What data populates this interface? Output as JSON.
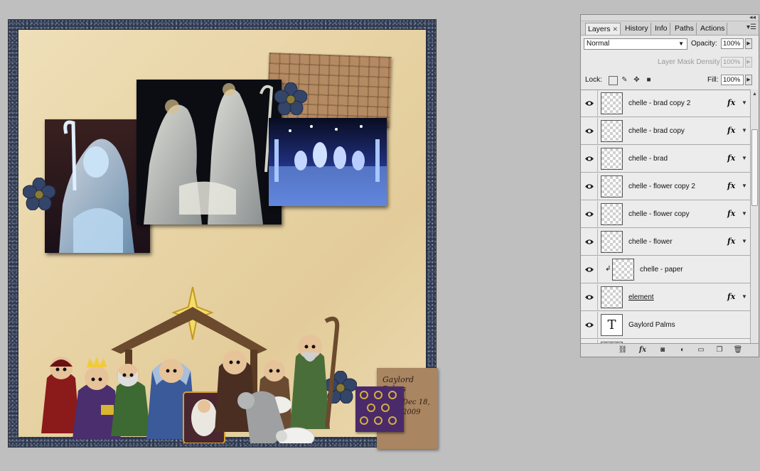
{
  "canvas": {
    "journaling_title": "Gaylord Palms",
    "journaling_date": "Dec 18, 2009"
  },
  "layers_panel": {
    "tabs": [
      {
        "label": "Layers",
        "active": true
      },
      {
        "label": "History",
        "active": false
      },
      {
        "label": "Info",
        "active": false
      },
      {
        "label": "Paths",
        "active": false
      },
      {
        "label": "Actions",
        "active": false
      }
    ],
    "blend_mode": "Normal",
    "opacity_label": "Opacity:",
    "opacity_value": "100%",
    "mask_density_label": "Layer Mask Density",
    "mask_density_value": "100%",
    "lock_label": "Lock:",
    "fill_label": "Fill:",
    "fill_value": "100%",
    "layers": [
      {
        "name": "chelle - brad copy 2",
        "thumb": "transparent",
        "fx": "fx"
      },
      {
        "name": "chelle - brad copy",
        "thumb": "transparent",
        "fx": "fx"
      },
      {
        "name": "chelle - brad",
        "thumb": "transparent",
        "fx": "fx"
      },
      {
        "name": "chelle - flower copy 2",
        "thumb": "transparent",
        "fx": "fx"
      },
      {
        "name": "chelle - flower copy",
        "thumb": "transparent",
        "fx": "fx"
      },
      {
        "name": "chelle - flower",
        "thumb": "transparent",
        "fx": "fx"
      },
      {
        "name": "chelle - paper",
        "thumb": "transparent",
        "fx": ""
      },
      {
        "name": "element",
        "thumb": "transparent",
        "fx": "fx"
      },
      {
        "name": "Gaylord Palms",
        "thumb": "T",
        "fx": ""
      }
    ]
  },
  "colors": {
    "workspace": "#bfbfbf",
    "frame": "#2e3a52",
    "paper": "#e8d4a6",
    "panel": "#e9e9e9"
  }
}
